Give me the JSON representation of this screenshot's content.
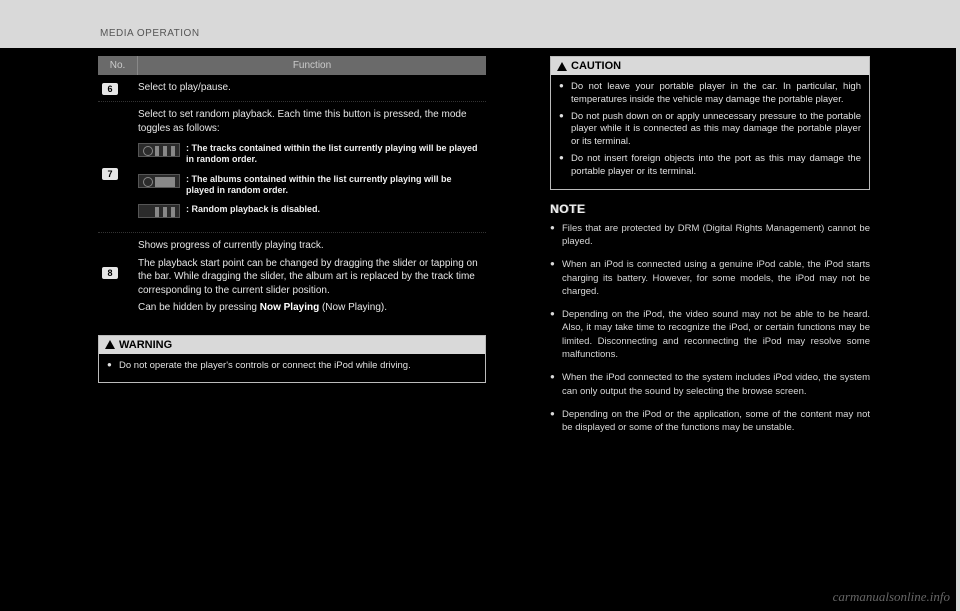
{
  "section_title": "MEDIA OPERATION",
  "table": {
    "head_no": "No.",
    "head_fn": "Function",
    "row6": {
      "num": "6",
      "text": "Select to play/pause."
    },
    "row7": {
      "num": "7",
      "intro": "Select to set random playback. Each time this button is pressed, the mode toggles as follows:",
      "modes": [
        {
          "icon": "shuffle-tracks-icon",
          "text": ": The tracks contained within the list currently playing will be played in random order."
        },
        {
          "icon": "shuffle-albums-icon",
          "text": ": The albums contained within the list currently playing will be played in random order."
        },
        {
          "icon": "shuffle-off-icon",
          "text": ": Random playback is disabled."
        }
      ]
    },
    "row8": {
      "num": "8",
      "p1": "Shows progress of currently playing track.",
      "p2_a": "The playback start point can be changed by dragging the slider or tapping on the bar. While dragging the slider, the album art is replaced by the track time corresponding to the current slider position.",
      "p3_a": "Can be hidden by pressing ",
      "p3_b": "Now Playing",
      "p3_c": " (Now Playing)."
    }
  },
  "warning": {
    "title": "WARNING",
    "items": [
      "Do not operate the player's controls or connect the iPod while driving."
    ]
  },
  "caution": {
    "title": "CAUTION",
    "items": [
      "Do not leave your portable player in the car. In particular, high temperatures inside the vehicle may damage the portable player.",
      "Do not push down on or apply unnecessary pressure to the portable player while it is connected as this may damage the portable player or its terminal.",
      "Do not insert foreign objects into the port as this may damage the portable player or its terminal."
    ]
  },
  "note": {
    "title": "NOTE",
    "items": [
      "Files that are protected by DRM (Digital Rights Management) cannot be played.",
      "When an iPod is connected using a genuine iPod cable, the iPod starts charging its battery. However, for some models, the iPod may not be charged.",
      "Depending on the iPod, the video sound may not be able to be heard. Also, it may take time to recognize the iPod, or certain functions may be limited. Disconnecting and reconnecting the iPod may resolve some malfunctions.",
      "When the iPod connected to the system includes iPod video, the system can only output the sound by selecting the browse screen.",
      "Depending on the iPod or the application, some of the content may not be displayed or some of the functions may be unstable."
    ]
  },
  "watermark": "carmanualsonline.info"
}
